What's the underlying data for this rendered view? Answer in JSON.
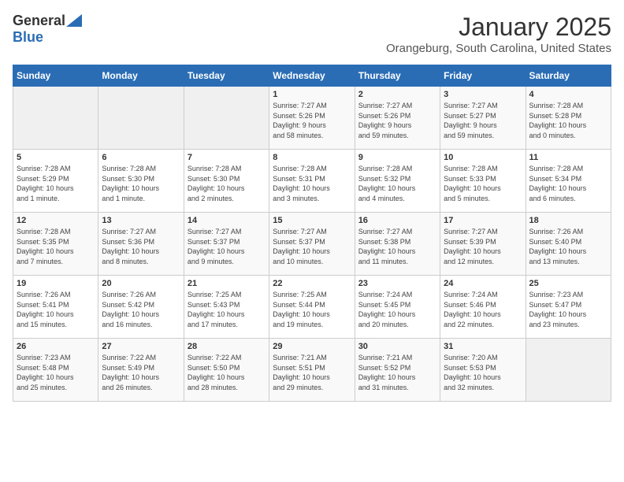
{
  "logo": {
    "general": "General",
    "blue": "Blue"
  },
  "title": "January 2025",
  "subtitle": "Orangeburg, South Carolina, United States",
  "days_of_week": [
    "Sunday",
    "Monday",
    "Tuesday",
    "Wednesday",
    "Thursday",
    "Friday",
    "Saturday"
  ],
  "weeks": [
    [
      {
        "day": "",
        "info": ""
      },
      {
        "day": "",
        "info": ""
      },
      {
        "day": "",
        "info": ""
      },
      {
        "day": "1",
        "info": "Sunrise: 7:27 AM\nSunset: 5:26 PM\nDaylight: 9 hours\nand 58 minutes."
      },
      {
        "day": "2",
        "info": "Sunrise: 7:27 AM\nSunset: 5:26 PM\nDaylight: 9 hours\nand 59 minutes."
      },
      {
        "day": "3",
        "info": "Sunrise: 7:27 AM\nSunset: 5:27 PM\nDaylight: 9 hours\nand 59 minutes."
      },
      {
        "day": "4",
        "info": "Sunrise: 7:28 AM\nSunset: 5:28 PM\nDaylight: 10 hours\nand 0 minutes."
      }
    ],
    [
      {
        "day": "5",
        "info": "Sunrise: 7:28 AM\nSunset: 5:29 PM\nDaylight: 10 hours\nand 1 minute."
      },
      {
        "day": "6",
        "info": "Sunrise: 7:28 AM\nSunset: 5:30 PM\nDaylight: 10 hours\nand 1 minute."
      },
      {
        "day": "7",
        "info": "Sunrise: 7:28 AM\nSunset: 5:30 PM\nDaylight: 10 hours\nand 2 minutes."
      },
      {
        "day": "8",
        "info": "Sunrise: 7:28 AM\nSunset: 5:31 PM\nDaylight: 10 hours\nand 3 minutes."
      },
      {
        "day": "9",
        "info": "Sunrise: 7:28 AM\nSunset: 5:32 PM\nDaylight: 10 hours\nand 4 minutes."
      },
      {
        "day": "10",
        "info": "Sunrise: 7:28 AM\nSunset: 5:33 PM\nDaylight: 10 hours\nand 5 minutes."
      },
      {
        "day": "11",
        "info": "Sunrise: 7:28 AM\nSunset: 5:34 PM\nDaylight: 10 hours\nand 6 minutes."
      }
    ],
    [
      {
        "day": "12",
        "info": "Sunrise: 7:28 AM\nSunset: 5:35 PM\nDaylight: 10 hours\nand 7 minutes."
      },
      {
        "day": "13",
        "info": "Sunrise: 7:27 AM\nSunset: 5:36 PM\nDaylight: 10 hours\nand 8 minutes."
      },
      {
        "day": "14",
        "info": "Sunrise: 7:27 AM\nSunset: 5:37 PM\nDaylight: 10 hours\nand 9 minutes."
      },
      {
        "day": "15",
        "info": "Sunrise: 7:27 AM\nSunset: 5:37 PM\nDaylight: 10 hours\nand 10 minutes."
      },
      {
        "day": "16",
        "info": "Sunrise: 7:27 AM\nSunset: 5:38 PM\nDaylight: 10 hours\nand 11 minutes."
      },
      {
        "day": "17",
        "info": "Sunrise: 7:27 AM\nSunset: 5:39 PM\nDaylight: 10 hours\nand 12 minutes."
      },
      {
        "day": "18",
        "info": "Sunrise: 7:26 AM\nSunset: 5:40 PM\nDaylight: 10 hours\nand 13 minutes."
      }
    ],
    [
      {
        "day": "19",
        "info": "Sunrise: 7:26 AM\nSunset: 5:41 PM\nDaylight: 10 hours\nand 15 minutes."
      },
      {
        "day": "20",
        "info": "Sunrise: 7:26 AM\nSunset: 5:42 PM\nDaylight: 10 hours\nand 16 minutes."
      },
      {
        "day": "21",
        "info": "Sunrise: 7:25 AM\nSunset: 5:43 PM\nDaylight: 10 hours\nand 17 minutes."
      },
      {
        "day": "22",
        "info": "Sunrise: 7:25 AM\nSunset: 5:44 PM\nDaylight: 10 hours\nand 19 minutes."
      },
      {
        "day": "23",
        "info": "Sunrise: 7:24 AM\nSunset: 5:45 PM\nDaylight: 10 hours\nand 20 minutes."
      },
      {
        "day": "24",
        "info": "Sunrise: 7:24 AM\nSunset: 5:46 PM\nDaylight: 10 hours\nand 22 minutes."
      },
      {
        "day": "25",
        "info": "Sunrise: 7:23 AM\nSunset: 5:47 PM\nDaylight: 10 hours\nand 23 minutes."
      }
    ],
    [
      {
        "day": "26",
        "info": "Sunrise: 7:23 AM\nSunset: 5:48 PM\nDaylight: 10 hours\nand 25 minutes."
      },
      {
        "day": "27",
        "info": "Sunrise: 7:22 AM\nSunset: 5:49 PM\nDaylight: 10 hours\nand 26 minutes."
      },
      {
        "day": "28",
        "info": "Sunrise: 7:22 AM\nSunset: 5:50 PM\nDaylight: 10 hours\nand 28 minutes."
      },
      {
        "day": "29",
        "info": "Sunrise: 7:21 AM\nSunset: 5:51 PM\nDaylight: 10 hours\nand 29 minutes."
      },
      {
        "day": "30",
        "info": "Sunrise: 7:21 AM\nSunset: 5:52 PM\nDaylight: 10 hours\nand 31 minutes."
      },
      {
        "day": "31",
        "info": "Sunrise: 7:20 AM\nSunset: 5:53 PM\nDaylight: 10 hours\nand 32 minutes."
      },
      {
        "day": "",
        "info": ""
      }
    ]
  ]
}
